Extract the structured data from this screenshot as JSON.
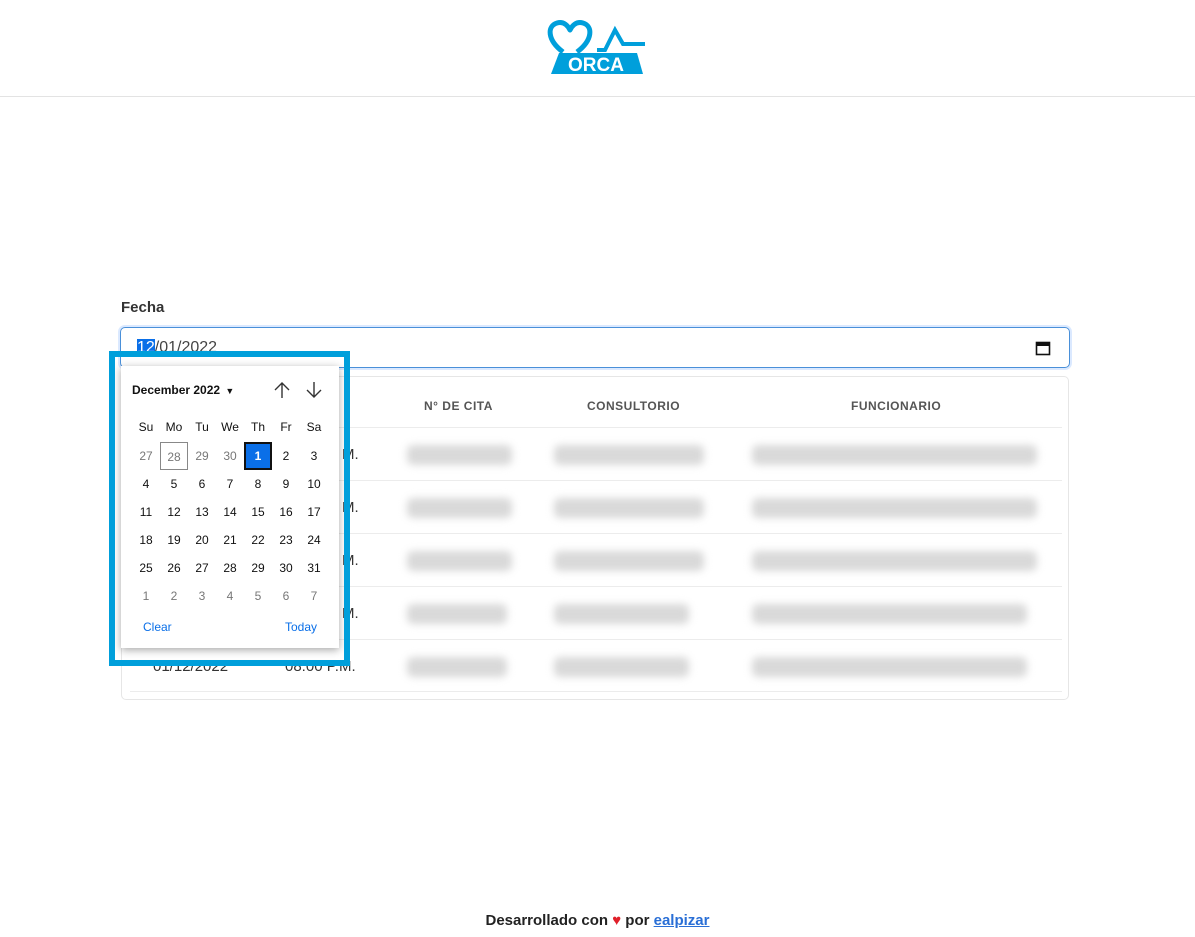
{
  "header": {
    "logo_text": "ORCA"
  },
  "form": {
    "fecha_label": "Fecha",
    "date_selected_part": "12",
    "date_rest": "/01/2022"
  },
  "table": {
    "headers": [
      "N° DE CITA",
      "CONSULTORIO",
      "FUNCIONARIO"
    ],
    "rows": [
      {
        "fecha": "",
        "hora": "M."
      },
      {
        "fecha": "",
        "hora": "M."
      },
      {
        "fecha": "",
        "hora": "M."
      },
      {
        "fecha": "",
        "hora": "M."
      },
      {
        "fecha": "01/12/2022",
        "hora": "08:00 P.M."
      }
    ]
  },
  "picker": {
    "month_label": "December 2022",
    "weekdays": [
      "Su",
      "Mo",
      "Tu",
      "We",
      "Th",
      "Fr",
      "Sa"
    ],
    "weeks": [
      [
        "27",
        "28",
        "29",
        "30",
        "1",
        "2",
        "3"
      ],
      [
        "4",
        "5",
        "6",
        "7",
        "8",
        "9",
        "10"
      ],
      [
        "11",
        "12",
        "13",
        "14",
        "15",
        "16",
        "17"
      ],
      [
        "18",
        "19",
        "20",
        "21",
        "22",
        "23",
        "24"
      ],
      [
        "25",
        "26",
        "27",
        "28",
        "29",
        "30",
        "31"
      ],
      [
        "1",
        "2",
        "3",
        "4",
        "5",
        "6",
        "7"
      ]
    ],
    "clear_label": "Clear",
    "today_label": "Today"
  },
  "footer": {
    "text_before": "Desarrollado con",
    "heart": "♥",
    "text_mid": "por",
    "link": "ealpizar"
  },
  "colors": {
    "brand": "#009fdb",
    "accent": "#0a6fe8",
    "heart": "#e0202a"
  },
  "icons": [
    "orca-logo-icon",
    "calendar-icon",
    "chevron-down-icon",
    "arrow-up-icon",
    "arrow-down-icon",
    "heart-icon"
  ]
}
